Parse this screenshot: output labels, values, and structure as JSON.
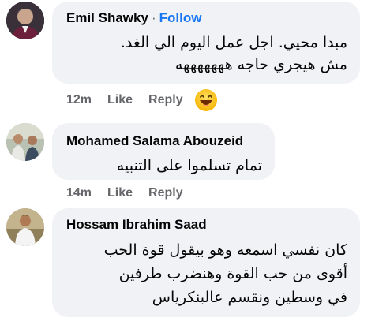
{
  "comments": [
    {
      "author": "Emil Shawky",
      "separator": "·",
      "follow_label": "Follow",
      "text_lines": [
        "مبدا محيي. اجل عمل اليوم الي الغد.",
        "مش هيجري حاجه هههههههه"
      ],
      "time": "12m",
      "like_label": "Like",
      "reply_label": "Reply",
      "reaction_icon": "laughing-emoji-icon"
    },
    {
      "author": "Mohamed Salama Abouzeid",
      "text_lines": [
        "تمام تسلموا على التنبيه"
      ],
      "time": "14m",
      "like_label": "Like",
      "reply_label": "Reply"
    },
    {
      "author": "Hossam Ibrahim Saad",
      "text_lines": [
        "كان نفسي اسمعه وهو بيقول قوة الحب",
        "أقوى من حب القوة وهنضرب طرفين",
        "في وسطين ونقسم عالبنكرياس"
      ]
    }
  ],
  "colors": {
    "bubble_bg": "#f0f2f5",
    "follow_link": "#1877f2",
    "meta_text": "#65676b"
  }
}
